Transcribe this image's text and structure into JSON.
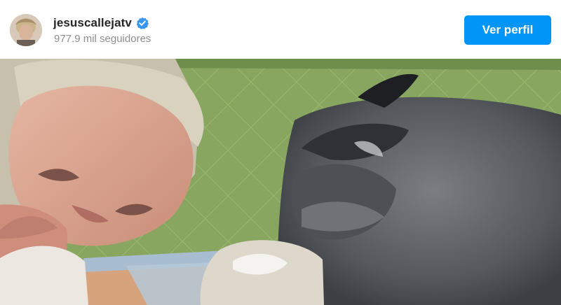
{
  "post": {
    "username": "jesuscallejatv",
    "followers": "977.9 mil seguidores",
    "profile_button": "Ver perfil",
    "verified": true
  },
  "icons": {
    "avatar": "user-avatar",
    "verified": "verified-badge-icon"
  },
  "colors": {
    "accent": "#0095f6",
    "username": "#262626",
    "secondary_text": "#8e8e8e"
  }
}
